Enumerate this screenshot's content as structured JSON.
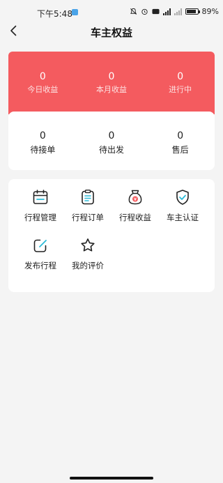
{
  "status_bar": {
    "time": "下午5:48",
    "network": "5G",
    "battery": "89%",
    "battery_level": 0.89
  },
  "header": {
    "title": "车主权益",
    "back_icon": "chevron-left-icon"
  },
  "earnings": {
    "accent": "#f45b5f",
    "items": [
      {
        "value": "0",
        "label": "今日收益"
      },
      {
        "value": "0",
        "label": "本月收益"
      },
      {
        "value": "0",
        "label": "进行中"
      }
    ]
  },
  "orders": {
    "items": [
      {
        "value": "0",
        "label": "待接单"
      },
      {
        "value": "0",
        "label": "待出发"
      },
      {
        "value": "0",
        "label": "售后"
      }
    ]
  },
  "menu": {
    "items": [
      {
        "label": "行程管理",
        "icon": "calendar-icon"
      },
      {
        "label": "行程订单",
        "icon": "clipboard-icon"
      },
      {
        "label": "行程收益",
        "icon": "money-bag-icon"
      },
      {
        "label": "车主认证",
        "icon": "shield-check-icon"
      },
      {
        "label": "发布行程",
        "icon": "edit-icon"
      },
      {
        "label": "我的评价",
        "icon": "star-icon"
      }
    ]
  }
}
